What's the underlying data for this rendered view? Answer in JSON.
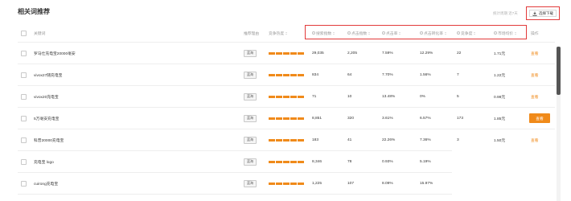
{
  "title": "相关词推荐",
  "hint": "统计周期  近7天",
  "download": {
    "label": "选择下载",
    "icon": "download-icon"
  },
  "columns": {
    "keyword": "关键词",
    "recommend": "推荐理由",
    "competition": "竞争热度",
    "search_index": "搜索指数",
    "click_index": "点击指数",
    "ctr": "点击率",
    "conversion": "点击转化率",
    "competitor_count": "竞争度",
    "avg_price": "市场均价",
    "action": "操作"
  },
  "rows": [
    {
      "keyword": "罗马仕充电宝20000毫安",
      "tag": "蓝海",
      "search_index": "29,035",
      "click_index": "2,205",
      "ctr": "7.59%",
      "conversion": "12.29%",
      "competitor_count": "22",
      "avg_price": "1.71元",
      "action": "查看",
      "action_style": "link"
    },
    {
      "keyword": "vivox27随充电宝",
      "tag": "蓝海",
      "search_index": "834",
      "click_index": "64",
      "ctr": "7.70%",
      "conversion": "1.56%",
      "competitor_count": "7",
      "avg_price": "1.22元",
      "action": "查看",
      "action_style": "link"
    },
    {
      "keyword": "vivox20充电宝",
      "tag": "蓝海",
      "search_index": "71",
      "click_index": "10",
      "ctr": "13.48%",
      "conversion": "0%",
      "competitor_count": "5",
      "avg_price": "0.98元",
      "action": "查看",
      "action_style": "link"
    },
    {
      "keyword": "5万毫安充电宝",
      "tag": "蓝海",
      "search_index": "8,851",
      "click_index": "320",
      "ctr": "3.61%",
      "conversion": "6.57%",
      "competitor_count": "173",
      "avg_price": "1.85元",
      "action": "查看",
      "action_style": "button"
    },
    {
      "keyword": "科普20000充电宝",
      "tag": "蓝海",
      "search_index": "183",
      "click_index": "41",
      "ctr": "22.26%",
      "conversion": "7.36%",
      "competitor_count": "3",
      "avg_price": "1.50元",
      "action": "查看",
      "action_style": "link"
    },
    {
      "keyword": "充电宝 logo",
      "tag": "蓝海",
      "search_index": "8,346",
      "click_index": "78",
      "ctr": "0.93%",
      "conversion": "5.19%",
      "competitor_count": "",
      "avg_price": "",
      "action": "",
      "action_style": "none"
    },
    {
      "keyword": "cuirong充电宝",
      "tag": "蓝海",
      "search_index": "1,225",
      "click_index": "107",
      "ctr": "8.09%",
      "conversion": "15.97%",
      "competitor_count": "34",
      "avg_price": "1.46元",
      "action": "",
      "action_style": "none"
    }
  ]
}
